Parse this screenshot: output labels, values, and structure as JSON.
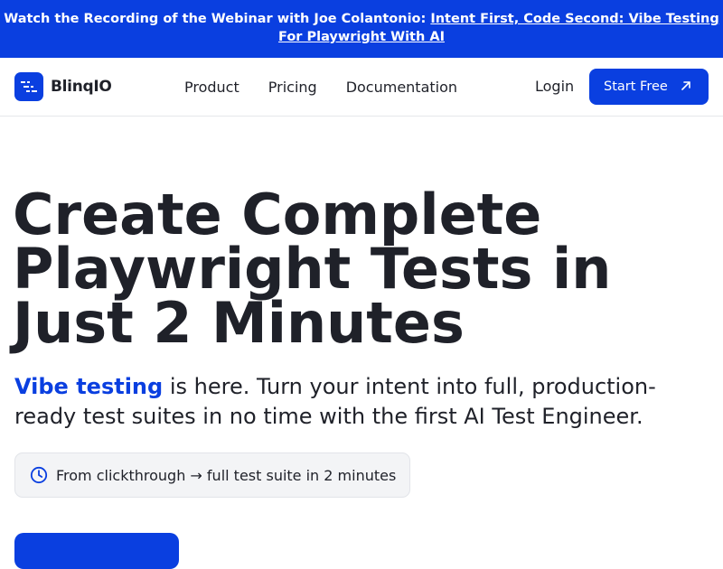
{
  "banner": {
    "prefix": "Watch the Recording of the Webinar with Joe Colantonio: ",
    "link": "Intent First, Code Second: Vibe Testing For Playwright With AI"
  },
  "nav": {
    "brand": "BlinqIO",
    "links": [
      "Product",
      "Pricing",
      "Documentation"
    ],
    "login": "Login",
    "cta": "Start Free",
    "cta_icon": "arrow-up-right-icon"
  },
  "hero": {
    "title_lines": [
      "Create Complete",
      "Playwright Tests in",
      "Just 2 Minutes"
    ],
    "sub_highlight": "Vibe testing",
    "sub_rest": " is here. Turn your intent into full, production-ready test suites in no time with the first AI Test Engineer.",
    "pill_icon": "clock-icon",
    "pill_text": "From clickthrough → full test suite in 2 minutes"
  },
  "colors": {
    "brand": "#0a3fe0",
    "text": "#1f2129",
    "pill_bg": "#f3f4f6"
  }
}
